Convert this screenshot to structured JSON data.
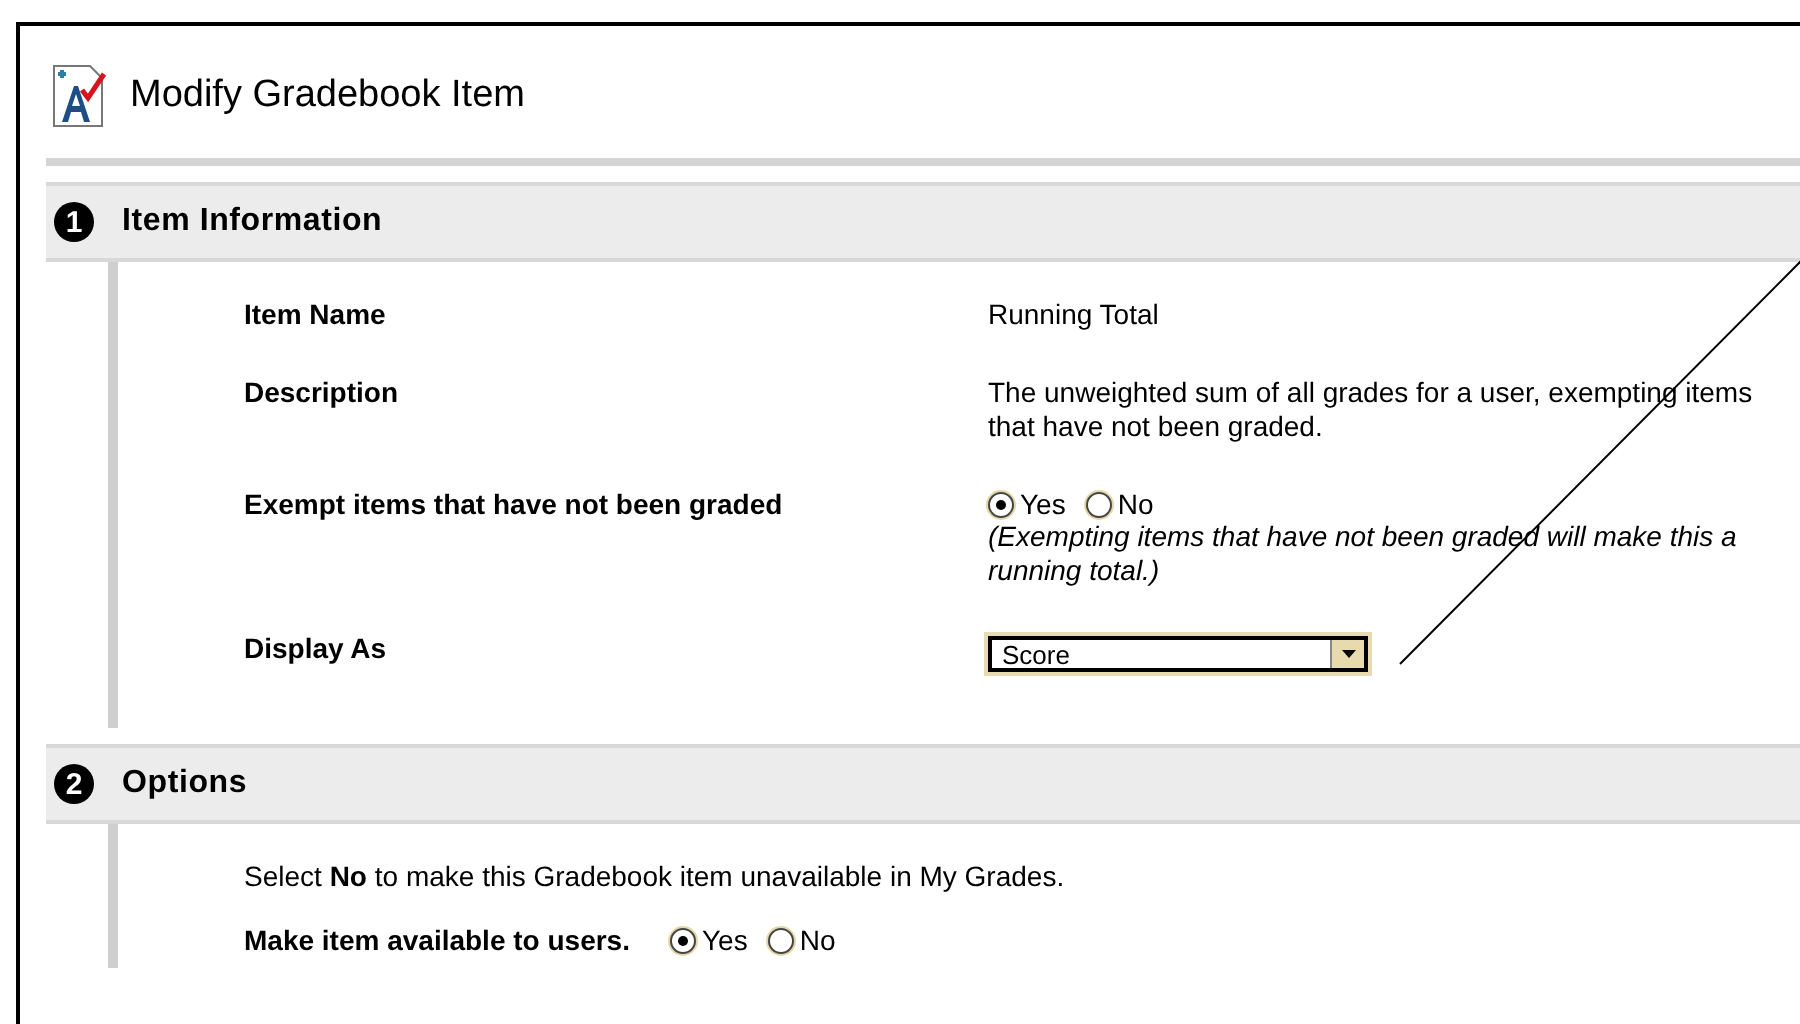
{
  "page": {
    "title": "Modify Gradebook Item"
  },
  "sections": [
    {
      "number": "1",
      "title": "Item Information",
      "rows": [
        {
          "kind": "text",
          "label": "Item Name",
          "value": "Running Total"
        },
        {
          "kind": "text",
          "label": "Description",
          "value": "The unweighted sum of all grades for a user, exempting items that have not been graded."
        },
        {
          "kind": "radio",
          "label": "Exempt items that have not been graded",
          "options": [
            {
              "label": "Yes",
              "selected": true
            },
            {
              "label": "No",
              "selected": false
            }
          ],
          "note": "(Exempting items that have not been graded will make this a running total.)"
        },
        {
          "kind": "select",
          "label": "Display As",
          "value": "Score"
        }
      ]
    },
    {
      "number": "2",
      "title": "Options",
      "intro": "Select **No** to make this Gradebook item unavailable in My Grades.",
      "rows": [
        {
          "kind": "radio",
          "label": "Make item available to users.",
          "options": [
            {
              "label": "Yes",
              "selected": true
            },
            {
              "label": "No",
              "selected": false
            }
          ]
        }
      ]
    }
  ]
}
